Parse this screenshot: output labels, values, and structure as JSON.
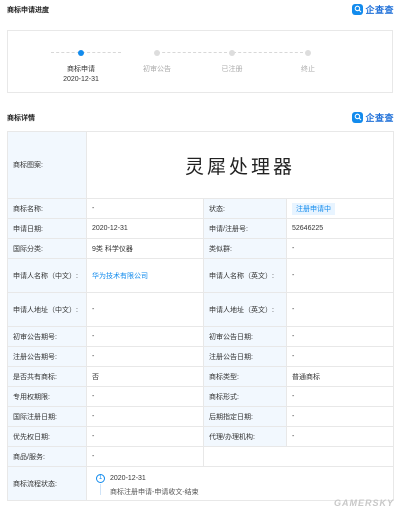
{
  "progress": {
    "title": "商标申请进度",
    "brand": "企查查",
    "steps": [
      {
        "label": "商标申请",
        "date": "2020-12-31",
        "active": true
      },
      {
        "label": "初审公告",
        "date": "",
        "active": false
      },
      {
        "label": "已注册",
        "date": "",
        "active": false
      },
      {
        "label": "终止",
        "date": "",
        "active": false
      }
    ]
  },
  "detail": {
    "title": "商标详情",
    "brand": "企查查",
    "mark_label": "商标图案:",
    "mark_text": "灵犀处理器",
    "rows": [
      {
        "l1": "商标名称:",
        "v1": "-",
        "l2": "状态:",
        "v2": "注册申请中"
      },
      {
        "l1": "申请日期:",
        "v1": "2020-12-31",
        "l2": "申请/注册号:",
        "v2": "52646225"
      },
      {
        "l1": "国际分类:",
        "v1": "9类 科学仪器",
        "l2": "类似群:",
        "v2": "-"
      },
      {
        "l1": "申请人名称（中文）:",
        "v1": "华为技术有限公司",
        "l2": "申请人名称（英文）:",
        "v2": "-"
      },
      {
        "l1": "申请人地址（中文）:",
        "v1": "-",
        "l2": "申请人地址（英文）:",
        "v2": "-"
      },
      {
        "l1": "初审公告期号:",
        "v1": "-",
        "l2": "初审公告日期:",
        "v2": "-"
      },
      {
        "l1": "注册公告期号:",
        "v1": "-",
        "l2": "注册公告日期:",
        "v2": "-"
      },
      {
        "l1": "是否共有商标:",
        "v1": "否",
        "l2": "商标类型:",
        "v2": "普通商标"
      },
      {
        "l1": "专用权期限:",
        "v1": "-",
        "l2": "商标形式:",
        "v2": "-"
      },
      {
        "l1": "国际注册日期:",
        "v1": "-",
        "l2": "后期指定日期:",
        "v2": "-"
      },
      {
        "l1": "优先权日期:",
        "v1": "-",
        "l2": "代理/办理机构:",
        "v2": "-"
      }
    ],
    "goods_label": "商品/服务:",
    "goods_value": "-",
    "flow_label": "商标流程状态:",
    "flow_index": "1",
    "flow_date": "2020-12-31",
    "flow_desc": "商标注册申请-申请收文-结束"
  },
  "watermark": "GAMERSKY",
  "colors": {
    "accent": "#128bed",
    "label_bg": "#f2f8fe",
    "border": "#e8e8e8"
  }
}
